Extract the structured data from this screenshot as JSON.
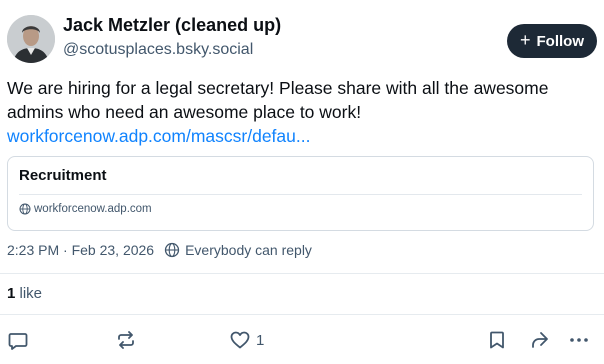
{
  "author": {
    "display_name": "Jack Metzler (cleaned up)",
    "handle": "@scotusplaces.bsky.social"
  },
  "follow_button": {
    "icon": "plus-icon",
    "label": "Follow"
  },
  "post": {
    "text": "We are hiring for a legal secretary! Please share with all the awesome admins who need an awesome place to work!",
    "link_text": "workforcenow.adp.com/mascsr/defau..."
  },
  "embed_card": {
    "title": "Recruitment",
    "domain": "workforcenow.adp.com"
  },
  "meta": {
    "timestamp": "2:23 PM · Feb 23, 2026",
    "reply_setting": "Everybody can reply"
  },
  "stats": {
    "likes_count": "1",
    "likes_label": "like"
  },
  "actions": {
    "reply_icon": "reply-icon",
    "repost_icon": "repost-icon",
    "like_icon": "heart-icon",
    "like_count": "1",
    "bookmark_icon": "bookmark-icon",
    "share_icon": "share-icon",
    "more_icon": "more-icon"
  },
  "colors": {
    "link": "#1083fe",
    "follow_bg": "#1d2936",
    "muted_text": "#42576c"
  }
}
